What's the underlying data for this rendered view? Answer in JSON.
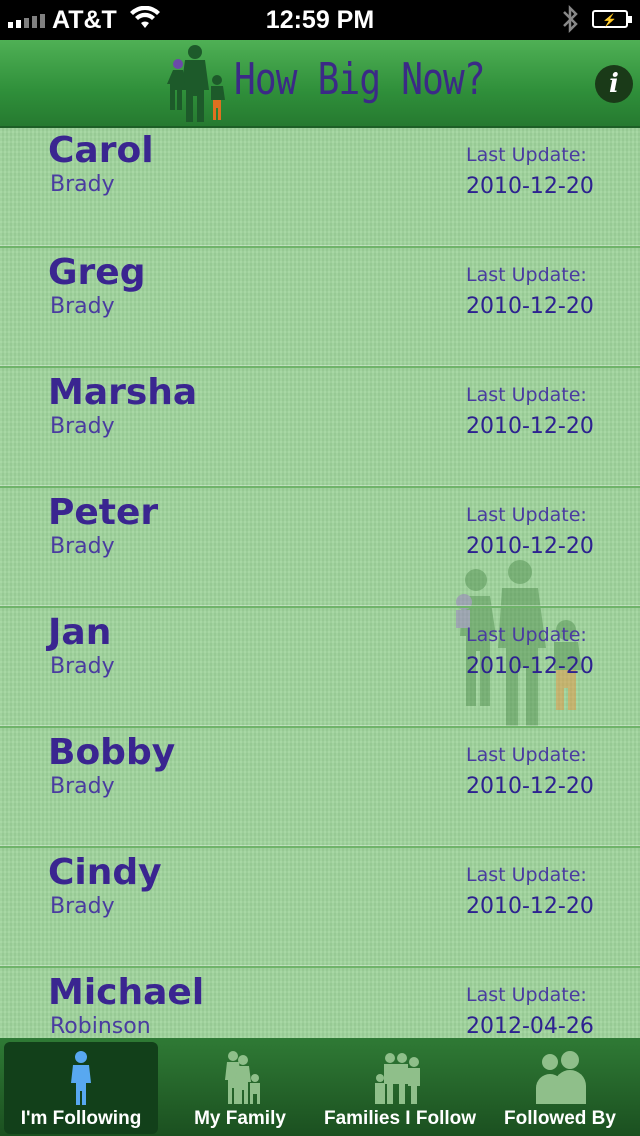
{
  "status_bar": {
    "carrier": "AT&T",
    "time": "12:59 PM"
  },
  "nav": {
    "title": "How Big Now?",
    "info_glyph": "i"
  },
  "list": {
    "items": [
      {
        "first": "Carol",
        "last": "Brady",
        "update_label": "Last Update:",
        "update_date": "2010-12-20"
      },
      {
        "first": "Greg",
        "last": "Brady",
        "update_label": "Last Update:",
        "update_date": "2010-12-20"
      },
      {
        "first": "Marsha",
        "last": "Brady",
        "update_label": "Last Update:",
        "update_date": "2010-12-20"
      },
      {
        "first": "Peter",
        "last": "Brady",
        "update_label": "Last Update:",
        "update_date": "2010-12-20"
      },
      {
        "first": "Jan",
        "last": "Brady",
        "update_label": "Last Update:",
        "update_date": "2010-12-20"
      },
      {
        "first": "Bobby",
        "last": "Brady",
        "update_label": "Last Update:",
        "update_date": "2010-12-20"
      },
      {
        "first": "Cindy",
        "last": "Brady",
        "update_label": "Last Update:",
        "update_date": "2010-12-20"
      },
      {
        "first": "Michael",
        "last": "Robinson",
        "update_label": "Last Update:",
        "update_date": "2012-04-26"
      }
    ]
  },
  "tabs": [
    {
      "label": "I'm Following",
      "icon": "child-icon",
      "selected": true
    },
    {
      "label": "My Family",
      "icon": "family-icon",
      "selected": false
    },
    {
      "label": "Families I Follow",
      "icon": "group-icon",
      "selected": false
    },
    {
      "label": "Followed By",
      "icon": "followers-icon",
      "selected": false
    }
  ],
  "colors": {
    "accent_purple": "#3a2590",
    "nav_green": "#2f8f3a",
    "list_green": "#9fd49c"
  }
}
